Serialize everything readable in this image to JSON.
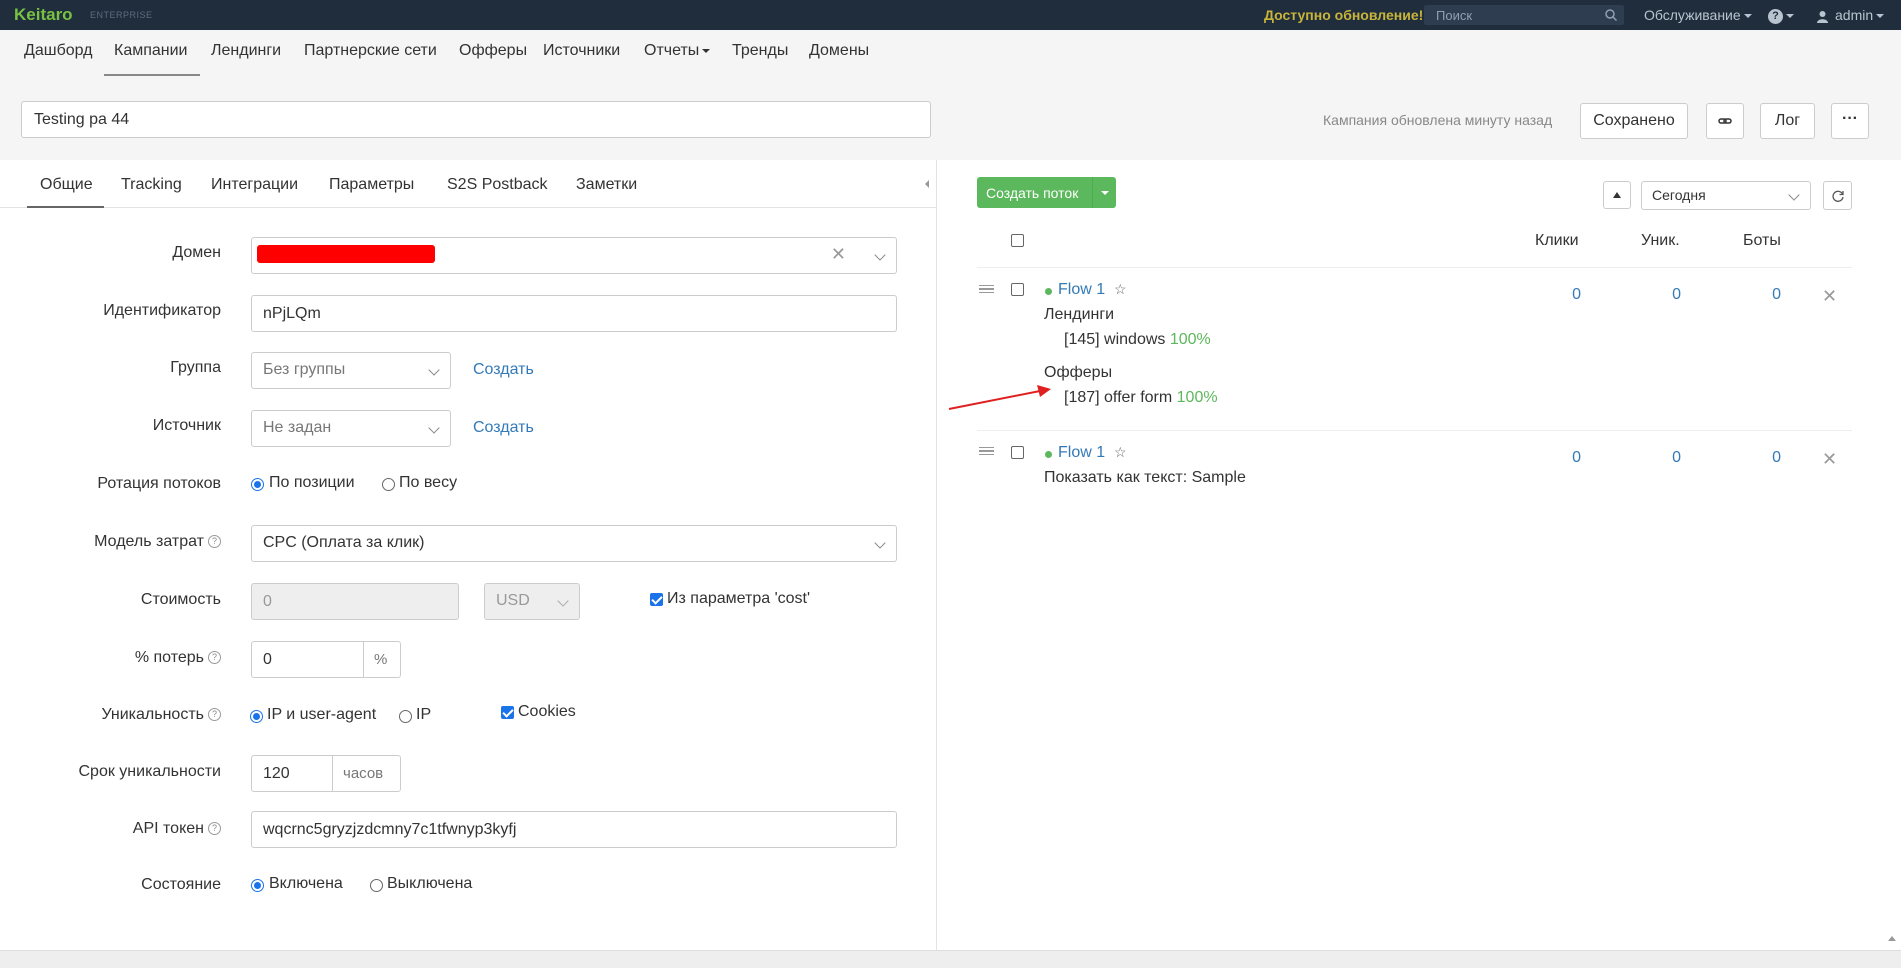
{
  "topbar": {
    "logo": "Keitaro",
    "edition": "ENTERPRISE",
    "update_notice": "Доступно обновление!",
    "search_placeholder": "Поиск",
    "service_menu": "Обслуживание",
    "help_menu": "?",
    "user_menu": "admin"
  },
  "nav": {
    "items": [
      "Дашборд",
      "Кампании",
      "Лендинги",
      "Партнерские сети",
      "Офферы",
      "Источники",
      "Отчеты",
      "Тренды",
      "Домены"
    ],
    "active": "Кампании"
  },
  "campaign": {
    "name": "Testing pa 44",
    "updated_text": "Кампания обновлена минуту назад",
    "saved_label": "Сохранено",
    "log_label": "Лог",
    "more_label": "···"
  },
  "tabs": [
    "Общие",
    "Tracking",
    "Интеграции",
    "Параметры",
    "S2S Postback",
    "Заметки"
  ],
  "form": {
    "domain_label": "Домен",
    "id_label": "Идентификатор",
    "id_value": "nPjLQm",
    "group_label": "Группа",
    "group_value": "Без группы",
    "group_create": "Создать",
    "source_label": "Источник",
    "source_value": "Не задан",
    "source_create": "Создать",
    "rotation_label": "Ротация потоков",
    "rotation_opt1": "По позиции",
    "rotation_opt2": "По весу",
    "cost_model_label": "Модель затрат",
    "cost_model_value": "CPC (Оплата за клик)",
    "cost_label": "Стоимость",
    "cost_value": "0",
    "currency_value": "USD",
    "cost_param_label": "Из параметра 'cost'",
    "loss_label": "% потерь",
    "loss_value": "0",
    "loss_unit": "%",
    "uniq_label": "Уникальность",
    "uniq_opt1": "IP и user-agent",
    "uniq_opt2": "IP",
    "uniq_cookies": "Cookies",
    "uniq_period_label": "Срок уникальности",
    "uniq_period_value": "120",
    "uniq_period_unit": "часов",
    "api_label": "API токен",
    "api_value": "wqcrnc5gryzjzdcmny7c1tfwnyp3kyfj",
    "state_label": "Состояние",
    "state_opt1": "Включена",
    "state_opt2": "Выключена"
  },
  "flows_panel": {
    "create_label": "Создать поток",
    "period_value": "Сегодня",
    "col_clicks": "Клики",
    "col_uniq": "Уник.",
    "col_bots": "Боты",
    "flows": [
      {
        "name": "Flow 1",
        "landings_title": "Лендинги",
        "landing_item": "[145] windows",
        "landing_pct": "100%",
        "offers_title": "Офферы",
        "offer_item": "[187] offer form",
        "offer_pct": "100%",
        "clicks": "0",
        "uniq": "0",
        "bots": "0"
      },
      {
        "name": "Flow 1",
        "text": "Показать как текст: Sample",
        "clicks": "0",
        "uniq": "0",
        "bots": "0"
      }
    ]
  }
}
